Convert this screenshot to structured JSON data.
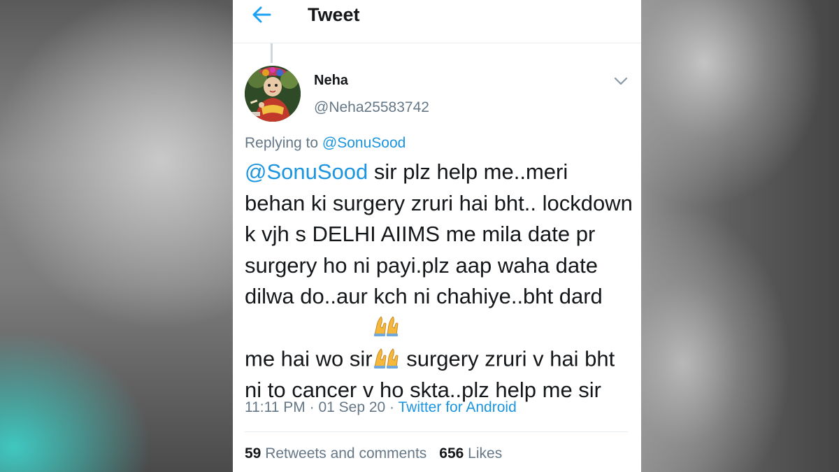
{
  "header": {
    "title": "Tweet",
    "back_icon": "back-arrow-icon"
  },
  "user": {
    "name": "Neha",
    "handle": "@Neha25583742",
    "avatar_icon": "deity-photo-avatar"
  },
  "reply": {
    "prefix": "Replying to ",
    "to": "@SonuSood"
  },
  "tweet": {
    "mention": "@SonuSood",
    "text_part1": " sir plz help me..meri behan ki surgery zruri hai bht.. lockdown k vjh s DELHI AIIMS me mila date pr surgery ho ni payi.plz aap waha date dilwa do..aur kch ni chahiye..bht dard me hai wo sir",
    "emoji_icon": "folded-hands-emoji-icon",
    "text_part2": " surgery zruri v hai bht ni to cancer v ho skta..plz help me sir"
  },
  "meta": {
    "time": "11:11 PM",
    "sep1": " · ",
    "date": "01 Sep 20",
    "sep2": " · ",
    "source": "Twitter for Android"
  },
  "stats": {
    "retweets_count": "59",
    "retweets_label": " Retweets and comments",
    "likes_count": "656",
    "likes_label": " Likes"
  },
  "colors": {
    "link": "#1b95e0",
    "text": "#14171a",
    "muted": "#657786",
    "divider": "#e6ecf0"
  }
}
